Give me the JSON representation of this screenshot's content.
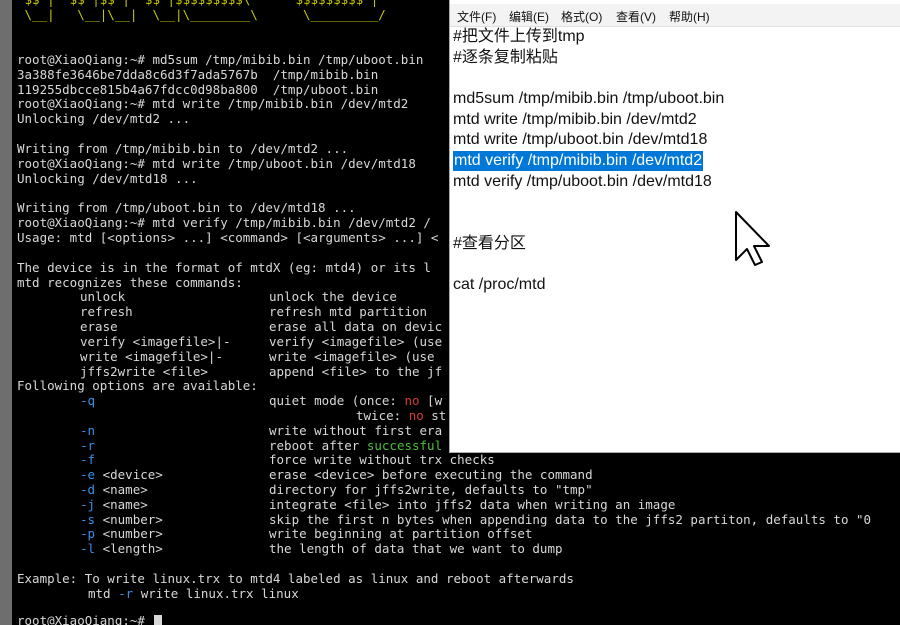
{
  "terminal": {
    "ascii_art": [
      " $$ |  $$ |$$ |  $$ |$$$$$$$$$\\      $$$$$$$$$ |",
      " \\__|   \\__|\\__|  \\__|\\________\\      \\_________/"
    ],
    "lines": [
      "root@XiaoQiang:~# md5sum /tmp/mibib.bin /tmp/uboot.bin",
      "3a388fe3646be7dda8c6d3f7ada5767b  /tmp/mibib.bin",
      "119255dbcce815b4a67fdcc0d98ba800  /tmp/uboot.bin",
      "root@XiaoQiang:~# mtd write /tmp/mibib.bin /dev/mtd2",
      "Unlocking /dev/mtd2 ...",
      "",
      "Writing from /tmp/mibib.bin to /dev/mtd2 ...",
      "root@XiaoQiang:~# mtd write /tmp/uboot.bin /dev/mtd18",
      "Unlocking /dev/mtd18 ...",
      "",
      "Writing from /tmp/uboot.bin to /dev/mtd18 ...",
      "root@XiaoQiang:~# mtd verify /tmp/mibib.bin /dev/mtd2 /",
      "Usage: mtd [<options> ...] <command> [<arguments> ...] <",
      "",
      "The device is in the format of mtdX (eg: mtd4) or its l",
      "mtd recognizes these commands:"
    ],
    "commands": [
      {
        "name": "unlock",
        "desc": "unlock the device"
      },
      {
        "name": "refresh",
        "desc": "refresh mtd partition"
      },
      {
        "name": "erase",
        "desc": "erase all data on devic"
      },
      {
        "name": "verify <imagefile>|-",
        "desc": "verify <imagefile> (use"
      },
      {
        "name": "write <imagefile>|-",
        "desc": "write <imagefile> (use"
      },
      {
        "name": "jffs2write <file>",
        "desc": "append <file> to the jf"
      }
    ],
    "options_header": "Following options are available:",
    "opt_q": {
      "flag": "-q",
      "desc_a": "quiet mode (once: ",
      "no": "no",
      "desc_b": " [w"
    },
    "opt_q2": {
      "desc_a": "twice: ",
      "no": "no",
      "desc_b": " st"
    },
    "opt_n": {
      "flag": "-n",
      "desc": "write without first era"
    },
    "opt_r": {
      "flag": "-r",
      "desc_a": "reboot after ",
      "successful": "successful"
    },
    "options": [
      {
        "flag": "-f",
        "arg": "",
        "desc": "force write without trx checks"
      },
      {
        "flag": "-e",
        "arg": " <device>",
        "desc": "erase <device> before executing the command"
      },
      {
        "flag": "-d",
        "arg": " <name>",
        "desc": "directory for jffs2write, defaults to \"tmp\""
      },
      {
        "flag": "-j",
        "arg": " <name>",
        "desc": "integrate <file> into jffs2 data when writing an image"
      },
      {
        "flag": "-s",
        "arg": " <number>",
        "desc": "skip the first n bytes when appending data to the jffs2 partiton, defaults to \"0"
      },
      {
        "flag": "-p",
        "arg": " <number>",
        "desc": "write beginning at partition offset"
      },
      {
        "flag": "-l",
        "arg": " <length>",
        "desc": "the length of data that we want to dump"
      }
    ],
    "example_line": "Example: To write linux.trx to mtd4 labeled as linux and reboot afterwards",
    "example_cmd_a": "mtd ",
    "example_cmd_flag": "-r",
    "example_cmd_b": " write linux.trx linux",
    "prompt": "root@XiaoQiang:~#"
  },
  "notepad": {
    "menu": [
      "文件(F)",
      "编辑(E)",
      "格式(O)",
      "查看(V)",
      "帮助(H)"
    ],
    "lines": [
      "#把文件上传到tmp",
      "#逐条复制粘贴",
      "",
      "md5sum /tmp/mibib.bin /tmp/uboot.bin",
      "mtd write /tmp/mibib.bin /dev/mtd2",
      "mtd write /tmp/uboot.bin /dev/mtd18",
      "mtd verify /tmp/mibib.bin /dev/mtd2",
      "mtd verify /tmp/uboot.bin /dev/mtd18",
      "",
      "",
      "#查看分区",
      "",
      "cat /proc/mtd"
    ],
    "selected_line": 6
  },
  "colors": {
    "terminal_bg": "#000000",
    "terminal_text": "#d8d8d8",
    "ascii_art": "#c8c800",
    "option_flag": "#3a8ee6",
    "no_text": "#d43c3c",
    "successful_text": "#4ebf3a",
    "selection_bg": "#0078d7"
  },
  "icons": {
    "mouse": "arrow-pointer-icon"
  }
}
